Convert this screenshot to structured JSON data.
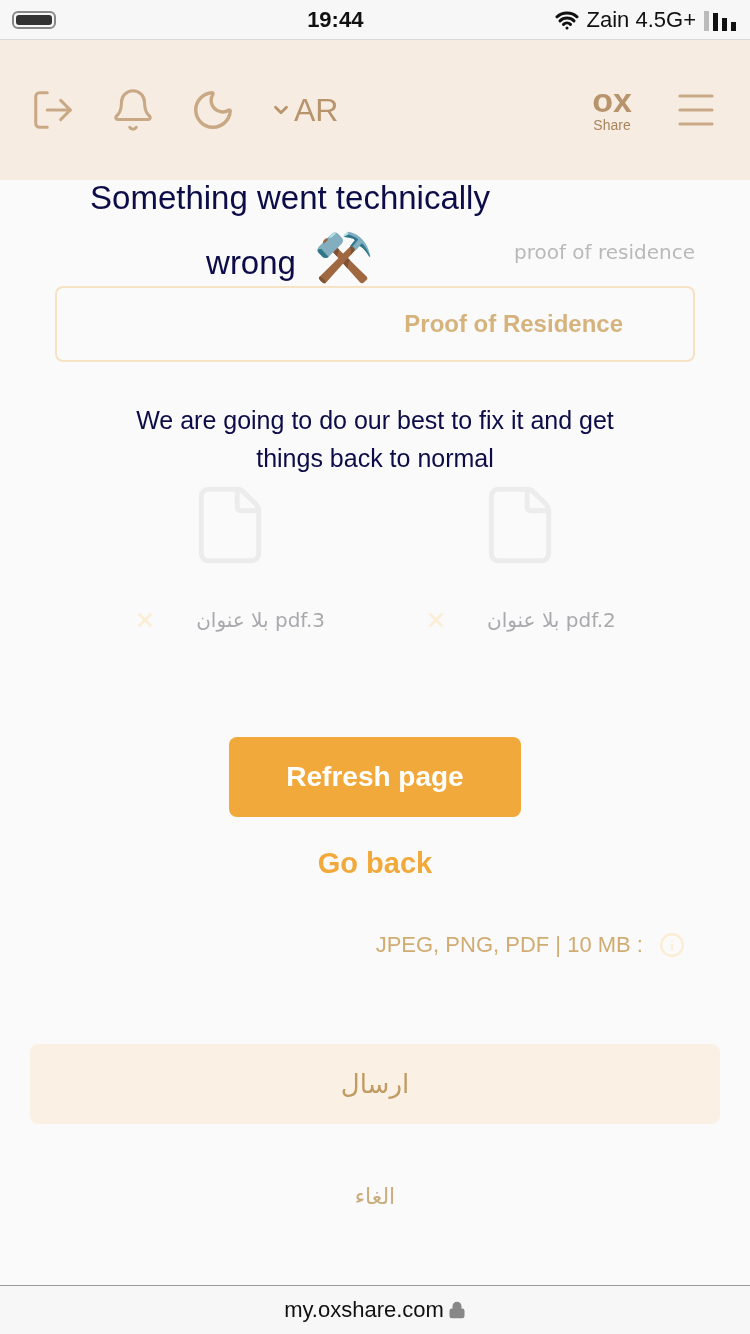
{
  "status_bar": {
    "time": "19:44",
    "carrier": "Zain 4.5G+"
  },
  "header": {
    "language": "AR",
    "logo": {
      "mark": "ox",
      "tagline": "Share"
    }
  },
  "form": {
    "section_label": "proof of residence",
    "field_value": "Proof of Residence",
    "files": [
      {
        "name": "بلا عنوان pdf.2"
      },
      {
        "name": "بلا عنوان pdf.3"
      }
    ],
    "file_hint": "JPEG, PNG, PDF | 10 MB :",
    "submit": "ارسال",
    "cancel": "الغاء"
  },
  "error": {
    "title": "Something went technically wrong",
    "emoji": "⚒️",
    "message": "We are going to do our best to fix it and get things back to normal",
    "refresh_button": "Refresh page",
    "back_link": "Go back"
  },
  "url_bar": {
    "address": "my.oxshare.com"
  }
}
